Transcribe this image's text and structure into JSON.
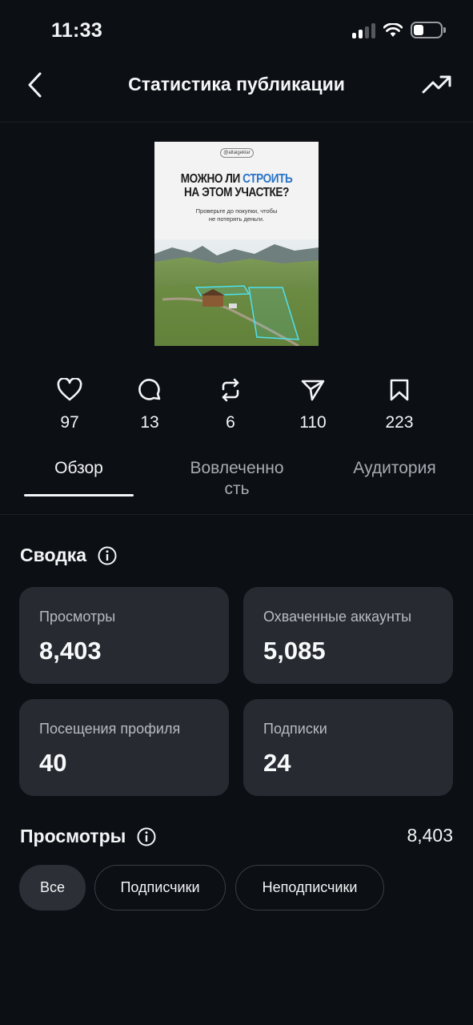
{
  "status": {
    "time": "11:33"
  },
  "header": {
    "title": "Статистика публикации"
  },
  "post": {
    "handle": "@altaigeklar",
    "headline_line1_a": "МОЖНО ЛИ ",
    "headline_line1_b": "СТРОИТЬ",
    "headline_line2": "НА ЭТОМ УЧАСТКЕ?",
    "subtext_line1": "Проверьте до покупки, чтобы",
    "subtext_line2": "не потерять деньги."
  },
  "engagement": [
    {
      "icon": "heart-icon",
      "value": "97"
    },
    {
      "icon": "comment-icon",
      "value": "13"
    },
    {
      "icon": "repost-icon",
      "value": "6"
    },
    {
      "icon": "share-icon",
      "value": "110"
    },
    {
      "icon": "bookmark-icon",
      "value": "223"
    }
  ],
  "tabs": {
    "overview": "Обзор",
    "engagement_line1": "Вовлеченно",
    "engagement_line2": "сть",
    "audience": "Аудитория"
  },
  "summary": {
    "title": "Сводка",
    "cards": [
      {
        "label": "Просмотры",
        "value": "8,403"
      },
      {
        "label": "Охваченные аккаунты",
        "value": "5,085"
      },
      {
        "label": "Посещения профиля",
        "value": "40"
      },
      {
        "label": "Подписки",
        "value": "24"
      }
    ]
  },
  "views": {
    "title": "Просмотры",
    "total": "8,403",
    "filters": [
      "Все",
      "Подписчики",
      "Неподписчики"
    ]
  },
  "colors": {
    "background": "#0c0f14",
    "card": "#272a31",
    "headline_accent": "#2a73c8"
  }
}
